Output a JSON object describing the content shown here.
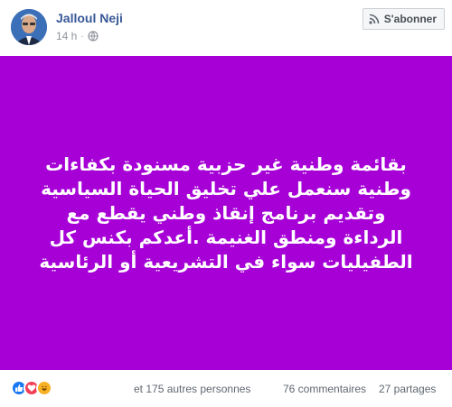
{
  "post": {
    "author": "Jalloul Neji",
    "time": "14 h",
    "separator": "·",
    "subscribe_label": "S'abonner",
    "background_color": "#a600d7",
    "text": "بقائمة وطنية غير حزبية مسنودة بكفاءات وطنية سنعمل علي تخليق الحياة السياسية وتقديم برنامج إنقاذ وطني يقطع مع الرداءة ومنطق الغنيمة .أعدكم بكنس كل الطفيليات سواء في التشريعية أو الرئاسية"
  },
  "footer": {
    "reactions": [
      "like-icon",
      "love-icon",
      "haha-icon"
    ],
    "others_text": "et 175 autres personnes",
    "comments_text": "76 commentaires",
    "shares_text": "27 partages"
  },
  "colors": {
    "link": "#385898",
    "muted": "#90949c",
    "like": "#1877f2",
    "love": "#f33e58",
    "haha": "#f7b125"
  }
}
